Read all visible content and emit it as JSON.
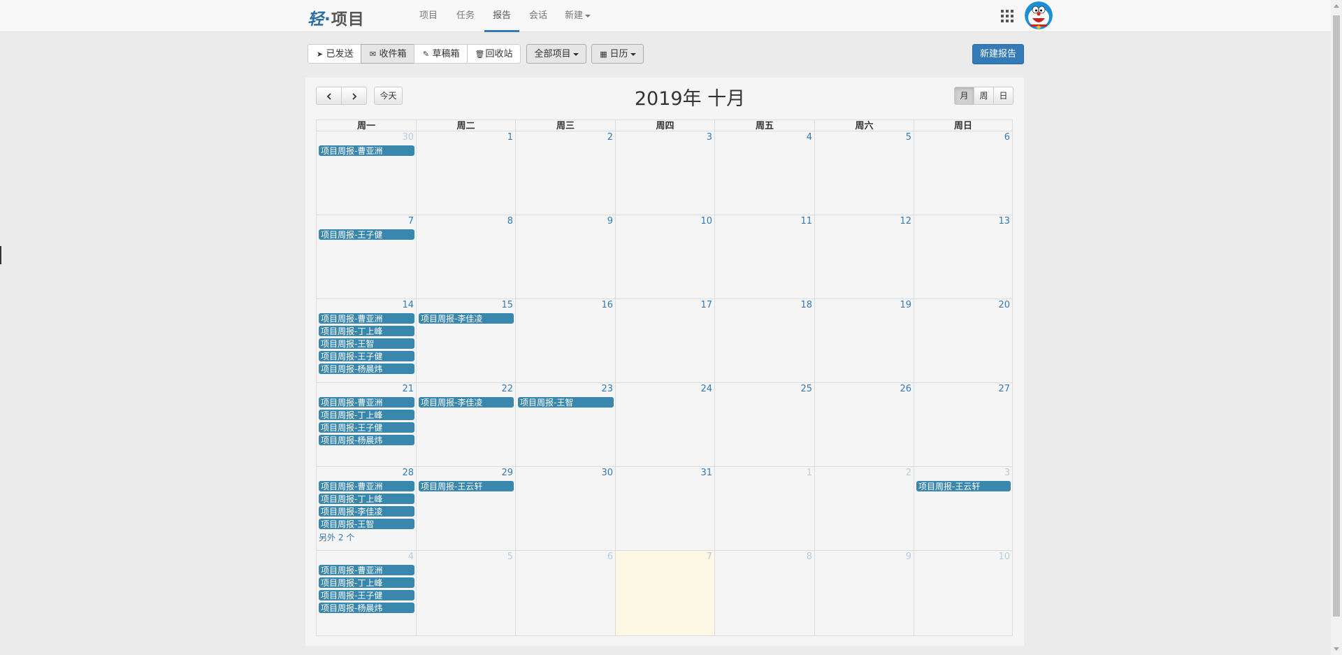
{
  "brand": {
    "char": "轻",
    "dot": "·",
    "name": "项目"
  },
  "nav": {
    "items": [
      "项目",
      "任务",
      "报告",
      "会话"
    ],
    "new_label": "新建",
    "active": "报告"
  },
  "icons": {
    "apps": "grid-icon",
    "avatar": "doraemon-avatar"
  },
  "toolbar": {
    "sent": "已发送",
    "inbox": "收件箱",
    "drafts": "草稿箱",
    "trash": "回收站",
    "all_projects": "全部项目",
    "calendar": "日历",
    "new_report": "新建报告"
  },
  "calendar": {
    "today_label": "今天",
    "title": "2019年 十月",
    "views": [
      "月",
      "周",
      "日"
    ],
    "active_view": "月",
    "weekdays": [
      "周一",
      "周二",
      "周三",
      "周四",
      "周五",
      "周六",
      "周日"
    ],
    "weeks": [
      [
        {
          "day": "30",
          "other": true,
          "events": [
            "项目周报-曹亚洲"
          ]
        },
        {
          "day": "1",
          "events": []
        },
        {
          "day": "2",
          "events": []
        },
        {
          "day": "3",
          "events": []
        },
        {
          "day": "4",
          "events": []
        },
        {
          "day": "5",
          "events": []
        },
        {
          "day": "6",
          "events": []
        }
      ],
      [
        {
          "day": "7",
          "events": [
            "项目周报-王子健"
          ]
        },
        {
          "day": "8",
          "events": []
        },
        {
          "day": "9",
          "events": []
        },
        {
          "day": "10",
          "events": []
        },
        {
          "day": "11",
          "events": []
        },
        {
          "day": "12",
          "events": []
        },
        {
          "day": "13",
          "events": []
        }
      ],
      [
        {
          "day": "14",
          "events": [
            "项目周报-曹亚洲",
            "项目周报-丁上峰",
            "项目周报-王智",
            "项目周报-王子健",
            "项目周报-杨晨炜"
          ]
        },
        {
          "day": "15",
          "events": [
            "项目周报-李佳凌"
          ]
        },
        {
          "day": "16",
          "events": []
        },
        {
          "day": "17",
          "events": []
        },
        {
          "day": "18",
          "events": []
        },
        {
          "day": "19",
          "events": []
        },
        {
          "day": "20",
          "events": []
        }
      ],
      [
        {
          "day": "21",
          "events": [
            "项目周报-曹亚洲",
            "项目周报-丁上峰",
            "项目周报-王子健",
            "项目周报-杨晨炜"
          ]
        },
        {
          "day": "22",
          "events": [
            "项目周报-李佳凌"
          ]
        },
        {
          "day": "23",
          "events": [
            "项目周报-王智"
          ]
        },
        {
          "day": "24",
          "events": []
        },
        {
          "day": "25",
          "events": []
        },
        {
          "day": "26",
          "events": []
        },
        {
          "day": "27",
          "events": []
        }
      ],
      [
        {
          "day": "28",
          "events": [
            "项目周报-曹亚洲",
            "项目周报-丁上峰",
            "项目周报-李佳凌",
            "项目周报-王智"
          ],
          "more": "另外 2 个"
        },
        {
          "day": "29",
          "events": [
            "项目周报-王云轩"
          ]
        },
        {
          "day": "30",
          "events": []
        },
        {
          "day": "31",
          "events": []
        },
        {
          "day": "1",
          "other": true,
          "events": []
        },
        {
          "day": "2",
          "other": true,
          "events": []
        },
        {
          "day": "3",
          "other": true,
          "events": [
            "项目周报-王云轩"
          ]
        }
      ],
      [
        {
          "day": "4",
          "other": true,
          "events": [
            "项目周报-曹亚洲",
            "项目周报-丁上峰",
            "项目周报-王子健",
            "项目周报-杨晨炜"
          ]
        },
        {
          "day": "5",
          "other": true,
          "events": []
        },
        {
          "day": "6",
          "other": true,
          "events": []
        },
        {
          "day": "7",
          "other": true,
          "today": true,
          "events": []
        },
        {
          "day": "8",
          "other": true,
          "events": []
        },
        {
          "day": "9",
          "other": true,
          "events": []
        },
        {
          "day": "10",
          "other": true,
          "events": []
        }
      ]
    ]
  }
}
